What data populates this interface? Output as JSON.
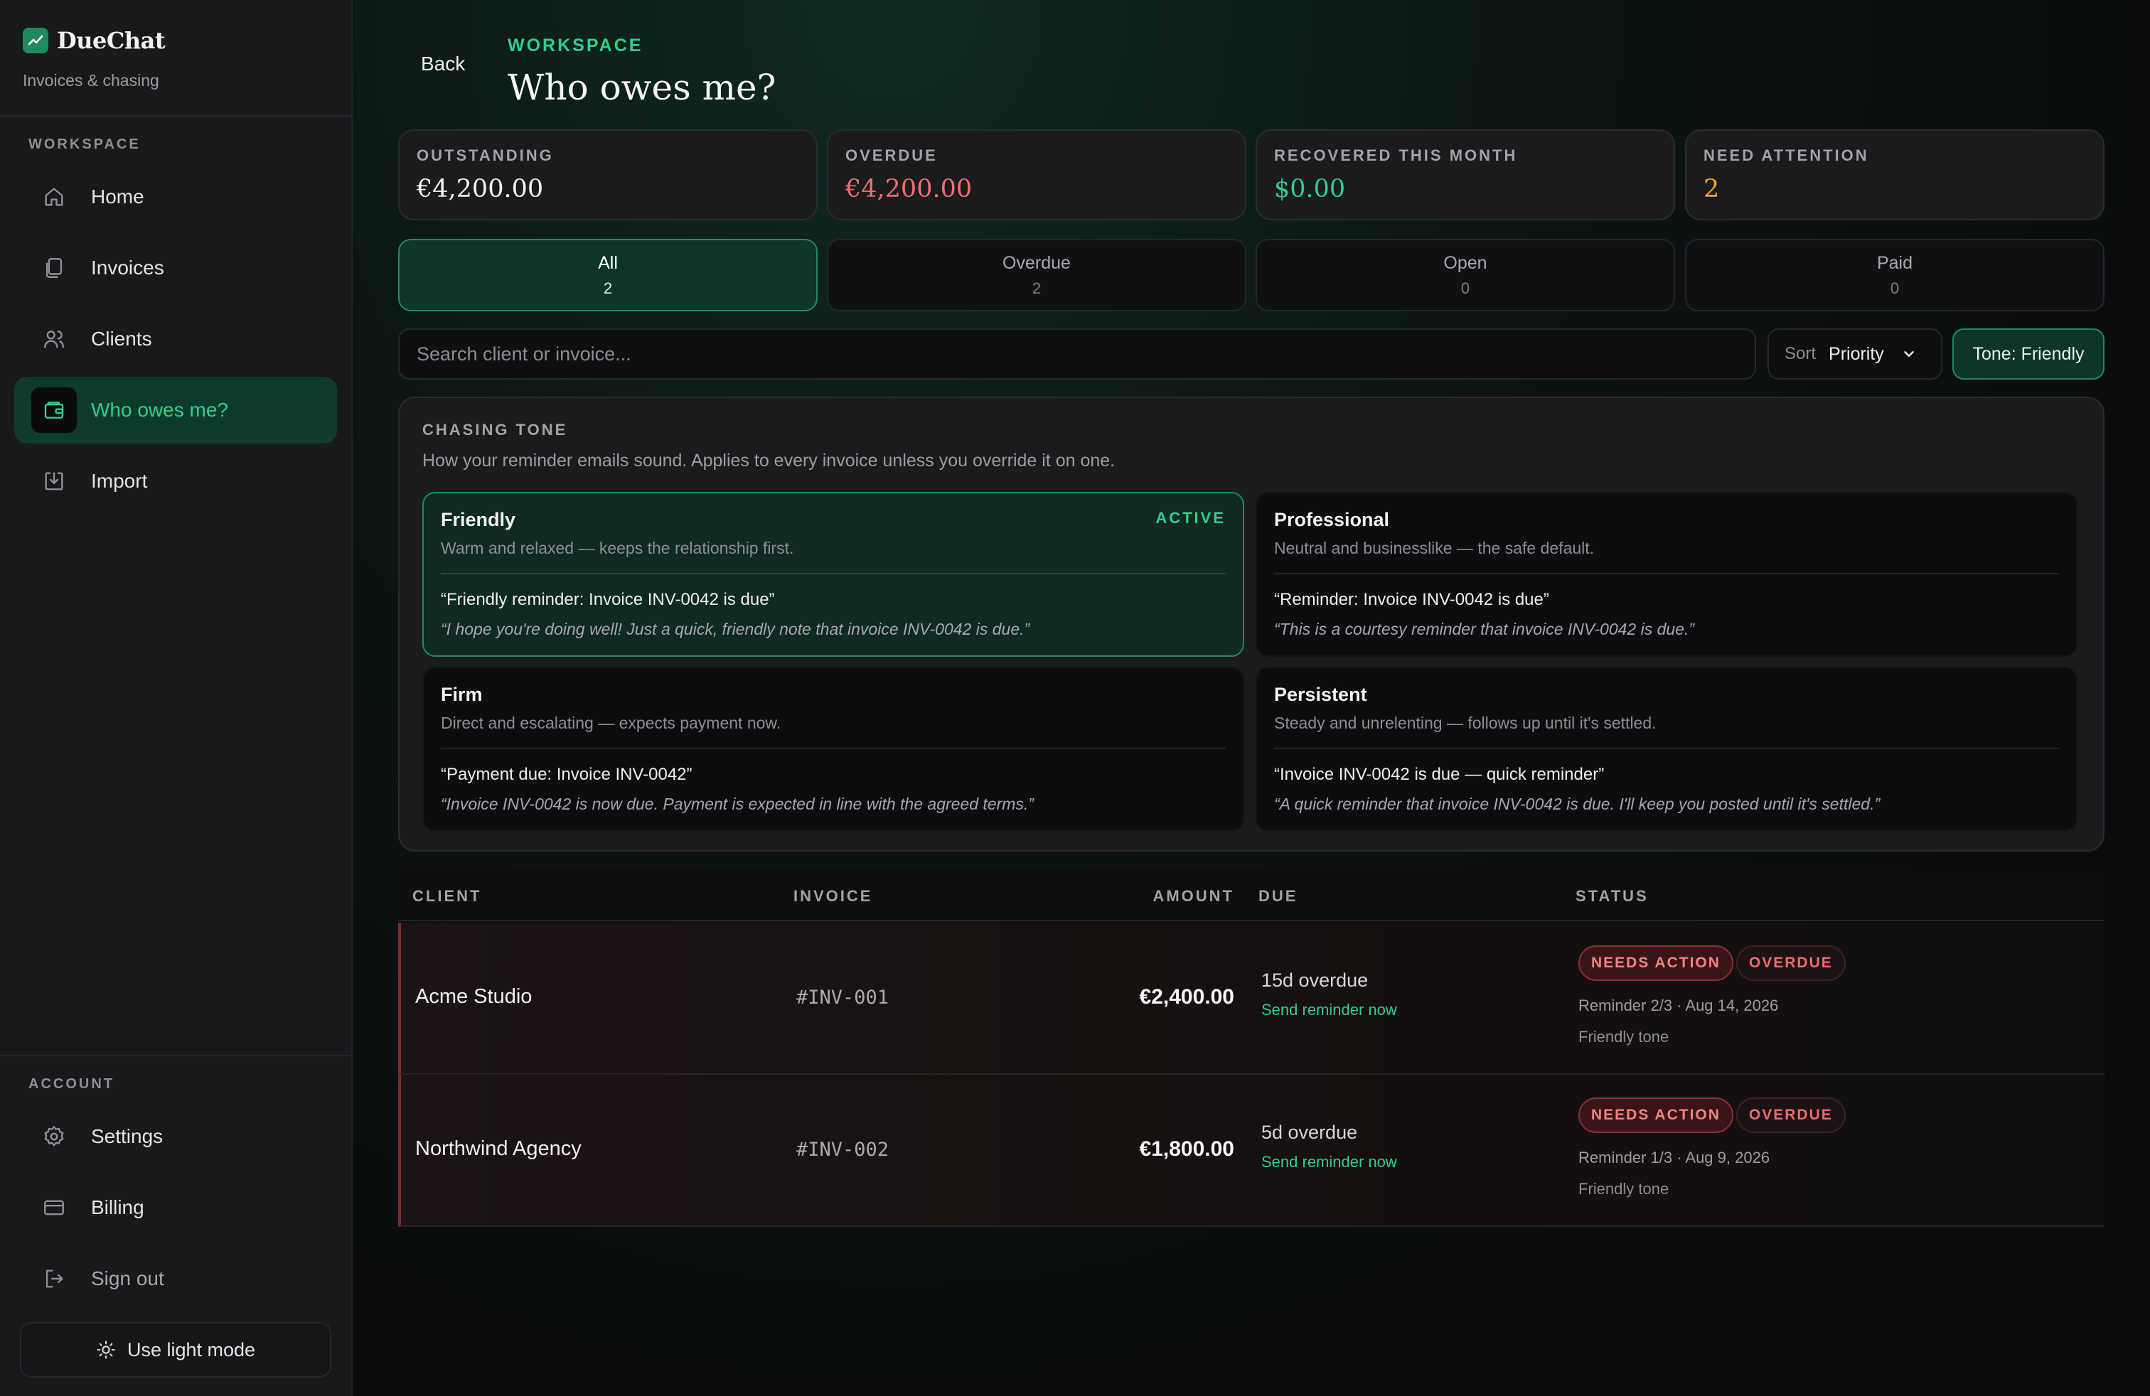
{
  "app": {
    "name": "DueChat",
    "subtitle": "Invoices & chasing"
  },
  "sidebar": {
    "workspace_label": "WORKSPACE",
    "account_label": "ACCOUNT",
    "items": [
      {
        "label": "Home",
        "icon": "home-icon"
      },
      {
        "label": "Invoices",
        "icon": "document-icon"
      },
      {
        "label": "Clients",
        "icon": "users-icon"
      },
      {
        "label": "Who owes me?",
        "icon": "wallet-icon",
        "active": true
      },
      {
        "label": "Import",
        "icon": "import-icon"
      }
    ],
    "account_items": [
      {
        "label": "Settings",
        "icon": "gear-icon"
      },
      {
        "label": "Billing",
        "icon": "card-icon"
      },
      {
        "label": "Sign out",
        "icon": "sign-out-icon"
      }
    ],
    "light_mode_label": "Use light mode"
  },
  "header": {
    "back_label": "Back",
    "eyebrow": "WORKSPACE",
    "title": "Who owes me?"
  },
  "stats": [
    {
      "label": "OUTSTANDING",
      "value": "€4,200.00",
      "color": "#f2f2f2"
    },
    {
      "label": "OVERDUE",
      "value": "€4,200.00",
      "color": "#f26f6f"
    },
    {
      "label": "RECOVERED THIS MONTH",
      "value": "$0.00",
      "color": "#2ecf8c"
    },
    {
      "label": "NEED ATTENTION",
      "value": "2",
      "color": "#f0a830"
    }
  ],
  "tabs": [
    {
      "label": "All",
      "count": "2",
      "active": true
    },
    {
      "label": "Overdue",
      "count": "2"
    },
    {
      "label": "Open",
      "count": "0"
    },
    {
      "label": "Paid",
      "count": "0"
    }
  ],
  "search": {
    "placeholder": "Search client or invoice...",
    "value": ""
  },
  "sort": {
    "label": "Sort",
    "value": "Priority"
  },
  "tone_button": "Tone: Friendly",
  "chasing_tone": {
    "title": "CHASING TONE",
    "description": "How your reminder emails sound. Applies to every invoice unless you override it on one.",
    "active_label": "ACTIVE",
    "tones": [
      {
        "name": "Friendly",
        "description": "Warm and relaxed — keeps the relationship first.",
        "subject": "“Friendly reminder: Invoice INV-0042 is due”",
        "body": "“I hope you're doing well! Just a quick, friendly note that invoice INV-0042 is due.”",
        "active": true
      },
      {
        "name": "Professional",
        "description": "Neutral and businesslike — the safe default.",
        "subject": "“Reminder: Invoice INV-0042 is due”",
        "body": "“This is a courtesy reminder that invoice INV-0042 is due.”"
      },
      {
        "name": "Firm",
        "description": "Direct and escalating — expects payment now.",
        "subject": "“Payment due: Invoice INV-0042”",
        "body": "“Invoice INV-0042 is now due. Payment is expected in line with the agreed terms.”"
      },
      {
        "name": "Persistent",
        "description": "Steady and unrelenting — follows up until it's settled.",
        "subject": "“Invoice INV-0042 is due — quick reminder”",
        "body": "“A quick reminder that invoice INV-0042 is due. I'll keep you posted until it's settled.”"
      }
    ]
  },
  "table": {
    "columns": [
      "CLIENT",
      "INVOICE",
      "AMOUNT",
      "DUE",
      "STATUS"
    ],
    "rows": [
      {
        "client": "Acme Studio",
        "invoice": "#INV-001",
        "amount": "€2,400.00",
        "due": "15d overdue",
        "action": "Send reminder now",
        "badges": [
          "NEEDS ACTION",
          "OVERDUE"
        ],
        "reminder": "Reminder 2/3 · Aug 14, 2026",
        "tone": "Friendly tone"
      },
      {
        "client": "Northwind Agency",
        "invoice": "#INV-002",
        "amount": "€1,800.00",
        "due": "5d overdue",
        "action": "Send reminder now",
        "badges": [
          "NEEDS ACTION",
          "OVERDUE"
        ],
        "reminder": "Reminder 1/3 · Aug 9, 2026",
        "tone": "Friendly tone"
      }
    ]
  },
  "colors": {
    "accent": "#2ecf8c",
    "danger": "#f26f6f",
    "warning": "#f0a830"
  }
}
